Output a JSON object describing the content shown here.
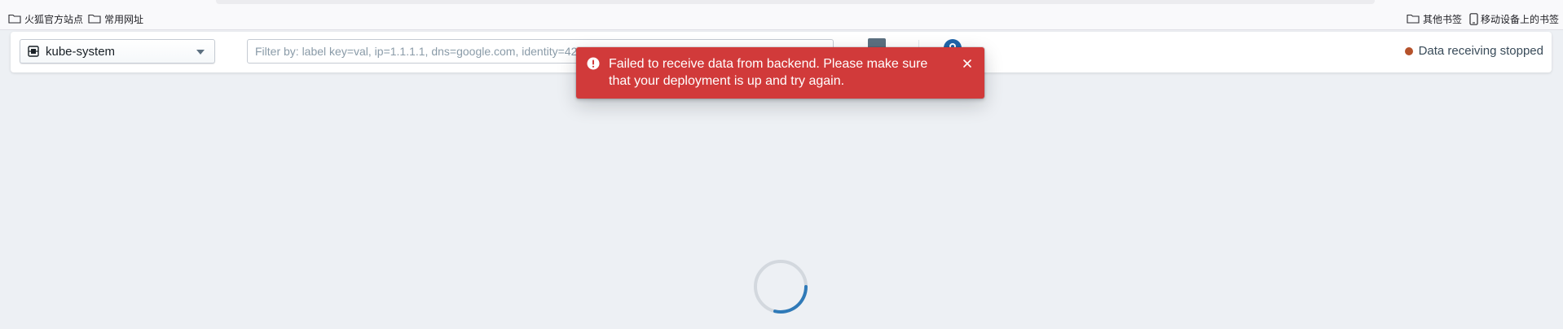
{
  "bookmarks_bar": {
    "left_items": [
      {
        "label": "火狐官方站点",
        "icon": "folder-icon"
      },
      {
        "label": "常用网址",
        "icon": "folder-icon"
      }
    ],
    "right_items": [
      {
        "label": "其他书签",
        "icon": "folder-icon"
      },
      {
        "label": "移动设备上的书签",
        "icon": "mobile-device-icon"
      }
    ]
  },
  "top_panel": {
    "namespace_select": {
      "value": "kube-system",
      "icon": "cube-icon"
    },
    "filter": {
      "placeholder": "Filter by: label key=val, ip=1.1.1.1, dns=google.com, identity=42, pod=frontend",
      "value": ""
    },
    "status": {
      "text": "Data receiving stopped",
      "dot_color": "#b5522b"
    }
  },
  "toast": {
    "message": "Failed to receive data from backend. Please make sure that your deployment is up and try again.",
    "background": "#d13a3a",
    "icon": "warning-sign-icon"
  },
  "loading": {
    "icon": "spinner-icon",
    "accent": "#2f7ab8"
  }
}
